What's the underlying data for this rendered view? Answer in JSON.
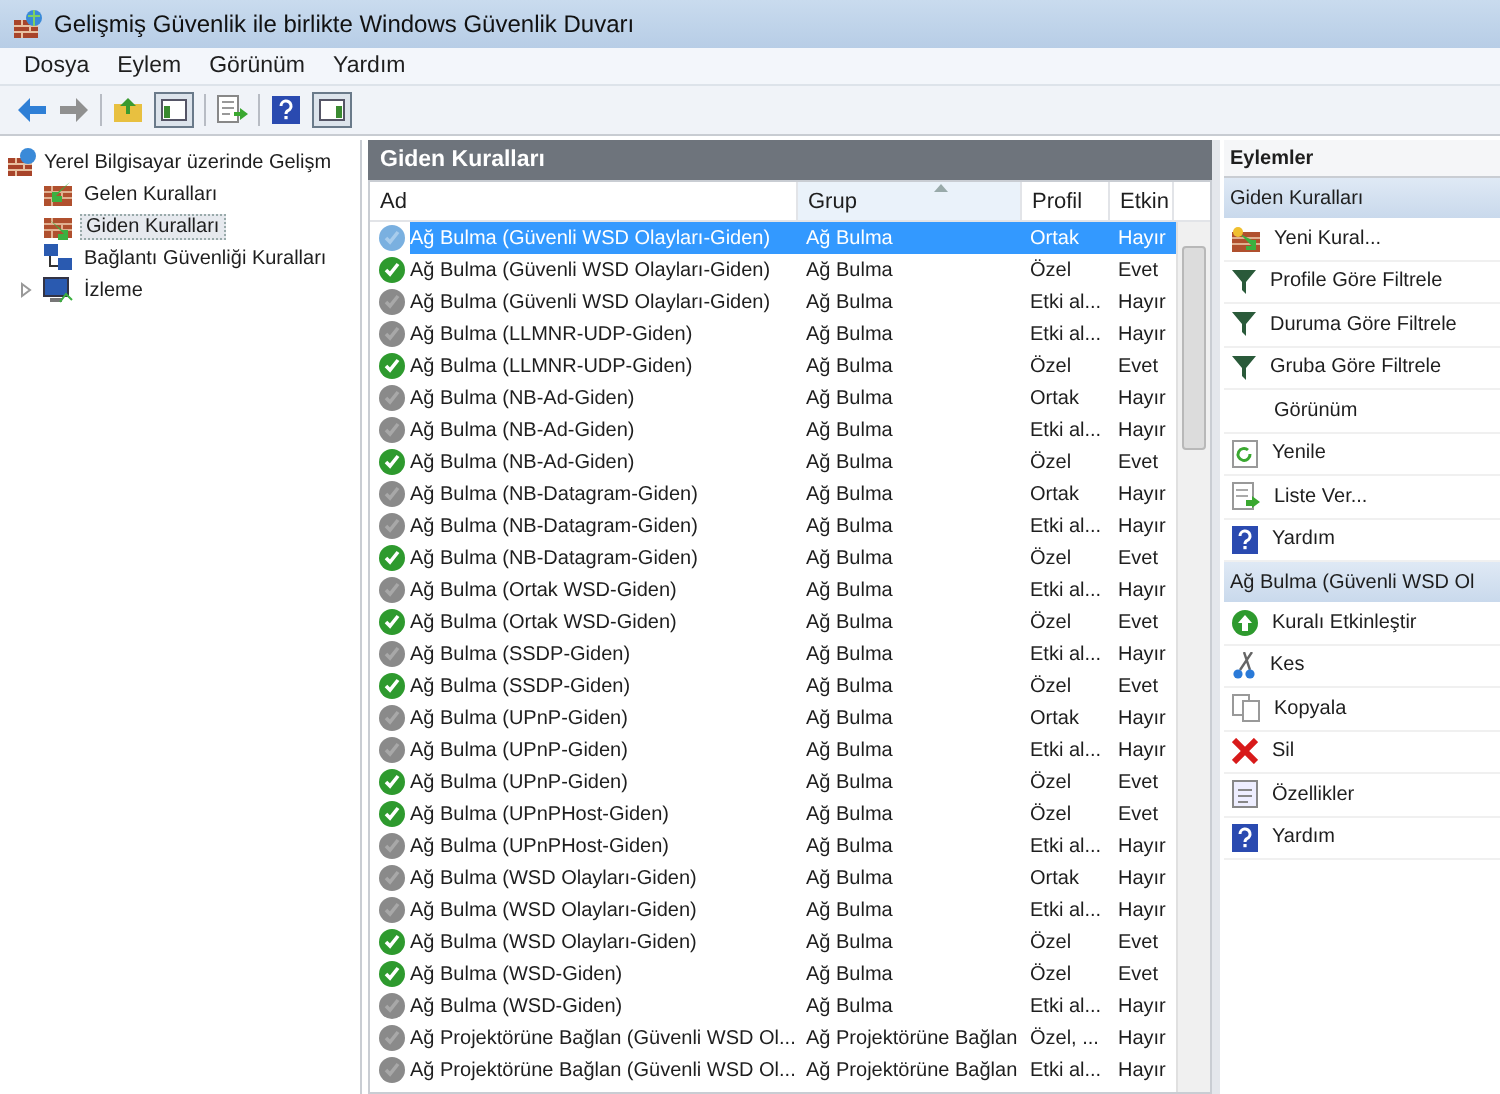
{
  "window": {
    "title": "Gelişmiş Güvenlik ile birlikte Windows Güvenlik Duvarı"
  },
  "menu": [
    "Dosya",
    "Eylem",
    "Görünüm",
    "Yardım"
  ],
  "tree": {
    "root": "Yerel Bilgisayar üzerinde Gelişm",
    "items": [
      {
        "label": "Gelen Kuralları",
        "kind": "inbound",
        "selected": false
      },
      {
        "label": "Giden Kuralları",
        "kind": "outbound",
        "selected": true
      },
      {
        "label": "Bağlantı Güvenliği Kuralları",
        "kind": "connection",
        "selected": false
      },
      {
        "label": "İzleme",
        "kind": "monitor",
        "selected": false,
        "expandable": true
      }
    ]
  },
  "panel": {
    "title": "Giden Kuralları",
    "columns": [
      "Ad",
      "Grup",
      "Profil",
      "Etkin"
    ],
    "rows": [
      {
        "name": "Ağ Bulma (Güvenli WSD Olayları-Giden)",
        "group": "Ağ Bulma",
        "profile": "Ortak",
        "enabled_text": "Hayır",
        "enabled": false,
        "selected": true
      },
      {
        "name": "Ağ Bulma (Güvenli WSD Olayları-Giden)",
        "group": "Ağ Bulma",
        "profile": "Özel",
        "enabled_text": "Evet",
        "enabled": true,
        "selected": false
      },
      {
        "name": "Ağ Bulma (Güvenli WSD Olayları-Giden)",
        "group": "Ağ Bulma",
        "profile": "Etki al...",
        "enabled_text": "Hayır",
        "enabled": false,
        "selected": false
      },
      {
        "name": "Ağ Bulma (LLMNR-UDP-Giden)",
        "group": "Ağ Bulma",
        "profile": "Etki al...",
        "enabled_text": "Hayır",
        "enabled": false,
        "selected": false
      },
      {
        "name": "Ağ Bulma (LLMNR-UDP-Giden)",
        "group": "Ağ Bulma",
        "profile": "Özel",
        "enabled_text": "Evet",
        "enabled": true,
        "selected": false
      },
      {
        "name": "Ağ Bulma (NB-Ad-Giden)",
        "group": "Ağ Bulma",
        "profile": "Ortak",
        "enabled_text": "Hayır",
        "enabled": false,
        "selected": false
      },
      {
        "name": "Ağ Bulma (NB-Ad-Giden)",
        "group": "Ağ Bulma",
        "profile": "Etki al...",
        "enabled_text": "Hayır",
        "enabled": false,
        "selected": false
      },
      {
        "name": "Ağ Bulma (NB-Ad-Giden)",
        "group": "Ağ Bulma",
        "profile": "Özel",
        "enabled_text": "Evet",
        "enabled": true,
        "selected": false
      },
      {
        "name": "Ağ Bulma (NB-Datagram-Giden)",
        "group": "Ağ Bulma",
        "profile": "Ortak",
        "enabled_text": "Hayır",
        "enabled": false,
        "selected": false
      },
      {
        "name": "Ağ Bulma (NB-Datagram-Giden)",
        "group": "Ağ Bulma",
        "profile": "Etki al...",
        "enabled_text": "Hayır",
        "enabled": false,
        "selected": false
      },
      {
        "name": "Ağ Bulma (NB-Datagram-Giden)",
        "group": "Ağ Bulma",
        "profile": "Özel",
        "enabled_text": "Evet",
        "enabled": true,
        "selected": false
      },
      {
        "name": "Ağ Bulma (Ortak WSD-Giden)",
        "group": "Ağ Bulma",
        "profile": "Etki al...",
        "enabled_text": "Hayır",
        "enabled": false,
        "selected": false
      },
      {
        "name": "Ağ Bulma (Ortak WSD-Giden)",
        "group": "Ağ Bulma",
        "profile": "Özel",
        "enabled_text": "Evet",
        "enabled": true,
        "selected": false
      },
      {
        "name": "Ağ Bulma (SSDP-Giden)",
        "group": "Ağ Bulma",
        "profile": "Etki al...",
        "enabled_text": "Hayır",
        "enabled": false,
        "selected": false
      },
      {
        "name": "Ağ Bulma (SSDP-Giden)",
        "group": "Ağ Bulma",
        "profile": "Özel",
        "enabled_text": "Evet",
        "enabled": true,
        "selected": false
      },
      {
        "name": "Ağ Bulma (UPnP-Giden)",
        "group": "Ağ Bulma",
        "profile": "Ortak",
        "enabled_text": "Hayır",
        "enabled": false,
        "selected": false
      },
      {
        "name": "Ağ Bulma (UPnP-Giden)",
        "group": "Ağ Bulma",
        "profile": "Etki al...",
        "enabled_text": "Hayır",
        "enabled": false,
        "selected": false
      },
      {
        "name": "Ağ Bulma (UPnP-Giden)",
        "group": "Ağ Bulma",
        "profile": "Özel",
        "enabled_text": "Evet",
        "enabled": true,
        "selected": false
      },
      {
        "name": "Ağ Bulma (UPnPHost-Giden)",
        "group": "Ağ Bulma",
        "profile": "Özel",
        "enabled_text": "Evet",
        "enabled": true,
        "selected": false
      },
      {
        "name": "Ağ Bulma (UPnPHost-Giden)",
        "group": "Ağ Bulma",
        "profile": "Etki al...",
        "enabled_text": "Hayır",
        "enabled": false,
        "selected": false
      },
      {
        "name": "Ağ Bulma (WSD Olayları-Giden)",
        "group": "Ağ Bulma",
        "profile": "Ortak",
        "enabled_text": "Hayır",
        "enabled": false,
        "selected": false
      },
      {
        "name": "Ağ Bulma (WSD Olayları-Giden)",
        "group": "Ağ Bulma",
        "profile": "Etki al...",
        "enabled_text": "Hayır",
        "enabled": false,
        "selected": false
      },
      {
        "name": "Ağ Bulma (WSD Olayları-Giden)",
        "group": "Ağ Bulma",
        "profile": "Özel",
        "enabled_text": "Evet",
        "enabled": true,
        "selected": false
      },
      {
        "name": "Ağ Bulma (WSD-Giden)",
        "group": "Ağ Bulma",
        "profile": "Özel",
        "enabled_text": "Evet",
        "enabled": true,
        "selected": false
      },
      {
        "name": "Ağ Bulma (WSD-Giden)",
        "group": "Ağ Bulma",
        "profile": "Etki al...",
        "enabled_text": "Hayır",
        "enabled": false,
        "selected": false
      },
      {
        "name": "Ağ Projektörüne Bağlan (Güvenli WSD Ol...",
        "group": "Ağ Projektörüne Bağlan",
        "profile": "Özel, ...",
        "enabled_text": "Hayır",
        "enabled": false,
        "selected": false
      },
      {
        "name": "Ağ Projektörüne Bağlan (Güvenli WSD Ol...",
        "group": "Ağ Projektörüne Bağlan",
        "profile": "Etki al...",
        "enabled_text": "Hayır",
        "enabled": false,
        "selected": false
      }
    ]
  },
  "actions": {
    "title": "Eylemler",
    "sections": [
      {
        "title": "Giden Kuralları",
        "items": [
          {
            "label": "Yeni Kural...",
            "kind": "new"
          },
          {
            "label": "Profile Göre Filtrele",
            "kind": "filter"
          },
          {
            "label": "Duruma Göre Filtrele",
            "kind": "filter"
          },
          {
            "label": "Gruba Göre Filtrele",
            "kind": "filter"
          },
          {
            "label": "Görünüm",
            "kind": "plain"
          },
          {
            "label": "Yenile",
            "kind": "refresh"
          },
          {
            "label": "Liste Ver...",
            "kind": "export"
          },
          {
            "label": "Yardım",
            "kind": "help"
          }
        ]
      },
      {
        "title": "Ağ Bulma (Güvenli WSD Ol",
        "items": [
          {
            "label": "Kuralı Etkinleştir",
            "kind": "enable"
          },
          {
            "label": "Kes",
            "kind": "cut"
          },
          {
            "label": "Kopyala",
            "kind": "copy"
          },
          {
            "label": "Sil",
            "kind": "delete"
          },
          {
            "label": "Özellikler",
            "kind": "properties"
          },
          {
            "label": "Yardım",
            "kind": "help"
          }
        ]
      }
    ]
  }
}
